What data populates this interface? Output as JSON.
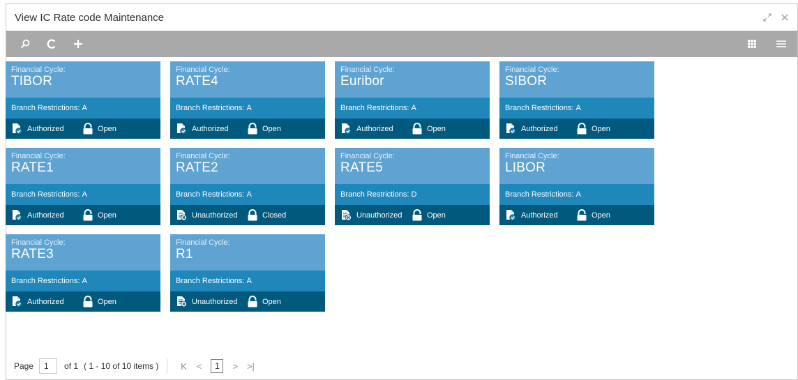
{
  "window": {
    "title": "View IC Rate code Maintenance"
  },
  "toolbar": {
    "left": [
      "search-icon",
      "refresh-icon",
      "add-icon"
    ],
    "right": [
      "tile-view-icon",
      "list-view-icon"
    ]
  },
  "labels": {
    "financial_cycle": "Financial Cycle:",
    "branch_restrictions": "Branch Restrictions:"
  },
  "cards": [
    {
      "cycle": "TIBOR",
      "branch": "A",
      "status": "Authorized",
      "lock": "Open"
    },
    {
      "cycle": "RATE4",
      "branch": "A",
      "status": "Authorized",
      "lock": "Open"
    },
    {
      "cycle": "Euribor",
      "branch": "A",
      "status": "Authorized",
      "lock": "Open"
    },
    {
      "cycle": "SIBOR",
      "branch": "A",
      "status": "Authorized",
      "lock": "Open"
    },
    {
      "cycle": "RATE1",
      "branch": "A",
      "status": "Authorized",
      "lock": "Open"
    },
    {
      "cycle": "RATE2",
      "branch": "A",
      "status": "Unauthorized",
      "lock": "Closed"
    },
    {
      "cycle": "RATE5",
      "branch": "D",
      "status": "Unauthorized",
      "lock": "Open"
    },
    {
      "cycle": "LIBOR",
      "branch": "A",
      "status": "Authorized",
      "lock": "Open"
    },
    {
      "cycle": "RATE3",
      "branch": "A",
      "status": "Authorized",
      "lock": "Open"
    },
    {
      "cycle": "R1",
      "branch": "A",
      "status": "Unauthorized",
      "lock": "Open"
    }
  ],
  "pager": {
    "label": "Page",
    "current": "1",
    "of_text": "of 1",
    "range_text": "( 1 - 10 of 10 items )",
    "first": "K",
    "prev": "<",
    "page_box": "1",
    "next": ">",
    "last": ">|"
  },
  "colors": {
    "card_top": "#5fa3d2",
    "card_mid": "#2087ba",
    "card_bottom": "#02597e",
    "toolbar": "#a9a9a9"
  }
}
